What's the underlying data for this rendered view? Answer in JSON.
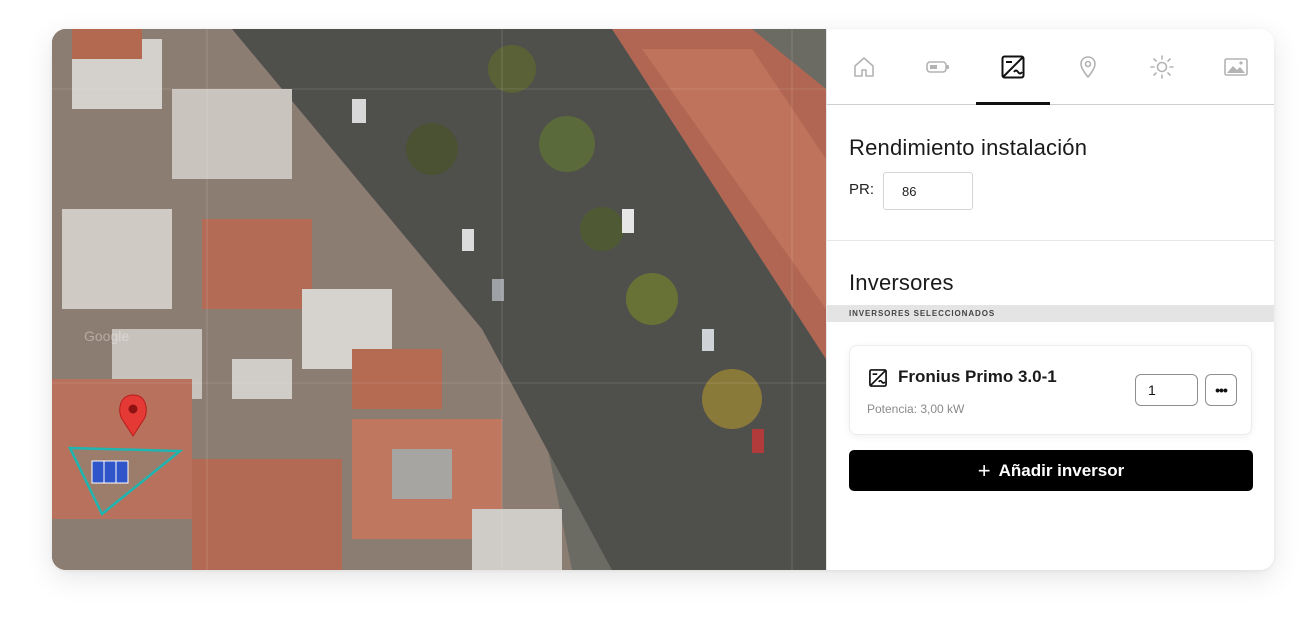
{
  "tabs": [
    {
      "name": "tab-home",
      "icon": "home-icon"
    },
    {
      "name": "tab-battery",
      "icon": "battery-icon"
    },
    {
      "name": "tab-inverter",
      "icon": "inverter-icon",
      "active": true
    },
    {
      "name": "tab-location",
      "icon": "location-pin-icon"
    },
    {
      "name": "tab-sun",
      "icon": "sun-icon"
    },
    {
      "name": "tab-image",
      "icon": "image-icon"
    }
  ],
  "performance": {
    "title": "Rendimiento instalación",
    "pr_label": "PR:",
    "pr_value": "86"
  },
  "inverters": {
    "title": "Inversores",
    "selected_label": "INVERSORES SELECCIONADOS",
    "items": [
      {
        "name": "Fronius Primo 3.0-1",
        "power": "Potencia: 3,00 kW",
        "quantity": "1",
        "more_label": "•••"
      }
    ],
    "add_button_label": "Añadir inversor",
    "add_button_icon": "plus-icon"
  },
  "map": {
    "watermark": "Google",
    "marker_color": "#e53935",
    "polygon_color": "#1fb5b0",
    "panel_color": "#2f55c8"
  }
}
